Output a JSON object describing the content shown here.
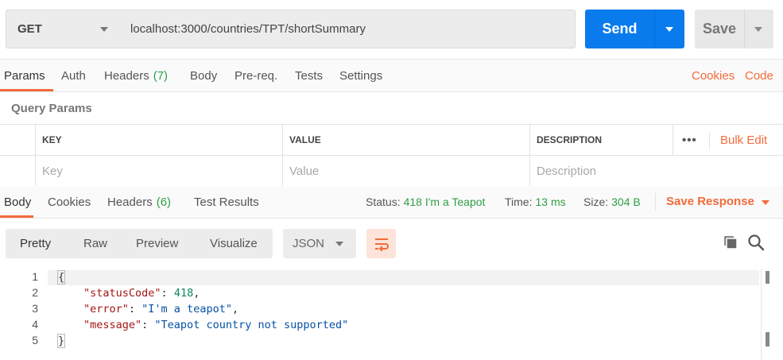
{
  "request": {
    "method": "GET",
    "url": "localhost:3000/countries/TPT/shortSummary",
    "send_label": "Send",
    "save_label": "Save"
  },
  "request_tabs": {
    "params": "Params",
    "auth": "Auth",
    "headers": "Headers",
    "headers_count": "(7)",
    "body": "Body",
    "prereq": "Pre-req.",
    "tests": "Tests",
    "settings": "Settings",
    "cookies": "Cookies",
    "code": "Code"
  },
  "query_params": {
    "title": "Query Params",
    "columns": [
      "KEY",
      "VALUE",
      "DESCRIPTION"
    ],
    "more": "•••",
    "bulk_edit": "Bulk Edit",
    "placeholders": [
      "Key",
      "Value",
      "Description"
    ]
  },
  "response_tabs": {
    "body": "Body",
    "cookies": "Cookies",
    "headers": "Headers",
    "headers_count": "(6)",
    "test_results": "Test Results",
    "status_label": "Status:",
    "status_value": "418 I'm a Teapot",
    "time_label": "Time:",
    "time_value": "13 ms",
    "size_label": "Size:",
    "size_value": "304 B",
    "save_response": "Save Response"
  },
  "view": {
    "modes": [
      "Pretty",
      "Raw",
      "Preview",
      "Visualize"
    ],
    "active_mode": "Pretty",
    "format": "JSON",
    "icons": [
      "wrap-lines-icon",
      "copy-icon",
      "search-icon"
    ]
  },
  "response_body": {
    "line_numbers": [
      "1",
      "2",
      "3",
      "4",
      "5"
    ],
    "open_brace": "{",
    "close_brace": "}",
    "fields": [
      {
        "key": "\"statusCode\"",
        "value": "418",
        "type": "number",
        "trail": ","
      },
      {
        "key": "\"error\"",
        "value": "\"I'm a teapot\"",
        "type": "string",
        "trail": ","
      },
      {
        "key": "\"message\"",
        "value": "\"Teapot country not supported\"",
        "type": "string",
        "trail": ""
      }
    ]
  },
  "colors": {
    "accent": "#f26b3a",
    "send": "#097bed",
    "success": "#2f9e44"
  }
}
